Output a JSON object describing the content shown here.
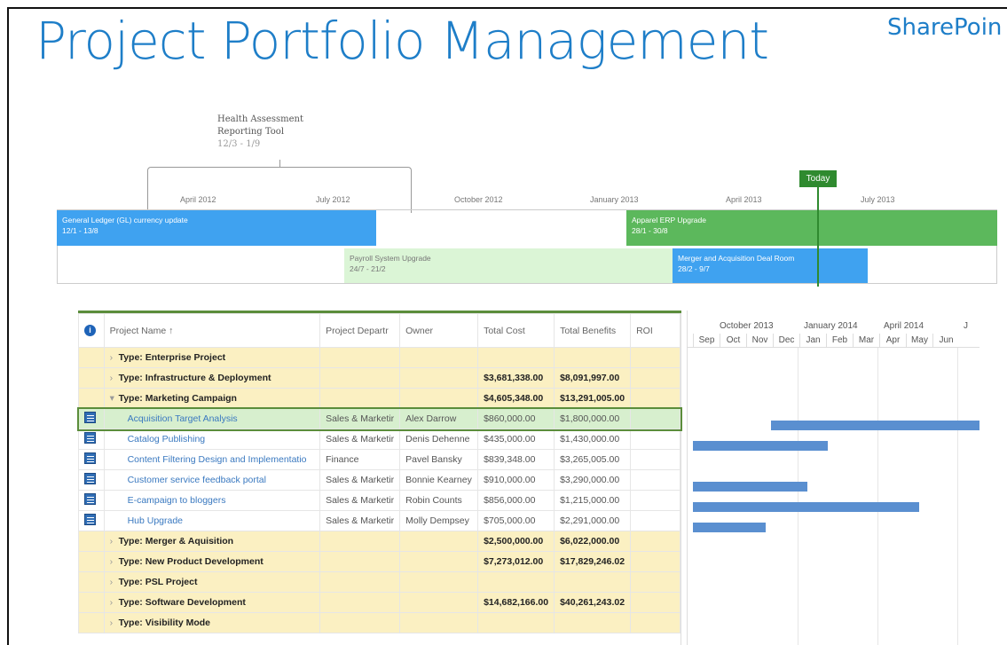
{
  "header": {
    "title": "Project Portfolio Management",
    "brand": "SharePoin"
  },
  "timeline": {
    "callout": {
      "line1": "Health Assessment",
      "line2": "Reporting Tool",
      "dates": "12/3 - 1/9"
    },
    "months": [
      "April 2012",
      "July 2012",
      "October 2012",
      "January 2013",
      "April 2013",
      "July 2013"
    ],
    "today_label": "Today",
    "bars": [
      {
        "name": "General Ledger (GL) currency update",
        "dates": "12/1 - 13/8"
      },
      {
        "name": "Apparel ERP Upgrade",
        "dates": "28/1 - 30/8"
      },
      {
        "name": "Payroll System Upgrade",
        "dates": "24/7 - 21/2"
      },
      {
        "name": "Merger and Acquisition Deal Room",
        "dates": "28/2 - 9/7"
      }
    ]
  },
  "grid": {
    "columns": [
      "Project Name ↑",
      "Project Departr",
      "Owner",
      "Total Cost",
      "Total Benefits",
      "ROI"
    ],
    "rows": [
      {
        "kind": "type",
        "name": "Type: Enterprise Project",
        "dept": "",
        "owner": "",
        "cost": "",
        "benefits": ""
      },
      {
        "kind": "type",
        "name": "Type: Infrastructure & Deployment",
        "dept": "",
        "owner": "",
        "cost": "$3,681,338.00",
        "benefits": "$8,091,997.00"
      },
      {
        "kind": "type",
        "name": "Type: Marketing Campaign",
        "dept": "",
        "owner": "",
        "cost": "$4,605,348.00",
        "benefits": "$13,291,005.00"
      },
      {
        "kind": "proj",
        "name": "Acquisition Target Analysis",
        "dept": "Sales & Marketir",
        "owner": "Alex Darrow",
        "cost": "$860,000.00",
        "benefits": "$1,800,000.00"
      },
      {
        "kind": "proj",
        "name": "Catalog Publishing",
        "dept": "Sales & Marketir",
        "owner": "Denis Dehenne",
        "cost": "$435,000.00",
        "benefits": "$1,430,000.00"
      },
      {
        "kind": "proj",
        "name": "Content Filtering Design and Implementatio",
        "dept": "Finance",
        "owner": "Pavel Bansky",
        "cost": "$839,348.00",
        "benefits": "$3,265,005.00"
      },
      {
        "kind": "proj",
        "name": "Customer service feedback portal",
        "dept": "Sales & Marketir",
        "owner": "Bonnie Kearney",
        "cost": "$910,000.00",
        "benefits": "$3,290,000.00"
      },
      {
        "kind": "proj",
        "name": "E-campaign to bloggers",
        "dept": "Sales & Marketir",
        "owner": "Robin Counts",
        "cost": "$856,000.00",
        "benefits": "$1,215,000.00"
      },
      {
        "kind": "proj",
        "name": "Hub Upgrade",
        "dept": "Sales & Marketir",
        "owner": "Molly Dempsey",
        "cost": "$705,000.00",
        "benefits": "$2,291,000.00"
      },
      {
        "kind": "type",
        "name": "Type: Merger & Aquisition",
        "dept": "",
        "owner": "",
        "cost": "$2,500,000.00",
        "benefits": "$6,022,000.00"
      },
      {
        "kind": "type",
        "name": "Type: New Product Development",
        "dept": "",
        "owner": "",
        "cost": "$7,273,012.00",
        "benefits": "$17,829,246.02"
      },
      {
        "kind": "type",
        "name": "Type: PSL Project",
        "dept": "",
        "owner": "",
        "cost": "",
        "benefits": ""
      },
      {
        "kind": "type",
        "name": "Type: Software Development",
        "dept": "",
        "owner": "",
        "cost": "$14,682,166.00",
        "benefits": "$40,261,243.02"
      },
      {
        "kind": "type",
        "name": "Type: Visibility Mode",
        "dept": "",
        "owner": "",
        "cost": "",
        "benefits": ""
      }
    ]
  },
  "gantt": {
    "quarters": [
      "October 2013",
      "January 2014",
      "April 2014",
      "J"
    ],
    "months": [
      "Sep",
      "Oct",
      "Nov",
      "Dec",
      "Jan",
      "Feb",
      "Mar",
      "Apr",
      "May",
      "Jun"
    ]
  },
  "colors": {
    "accent": "#1e7ec8",
    "type_row": "#fbf0c2",
    "selected_row": "#d7efce",
    "gantt_bar": "#5a8fd0"
  }
}
